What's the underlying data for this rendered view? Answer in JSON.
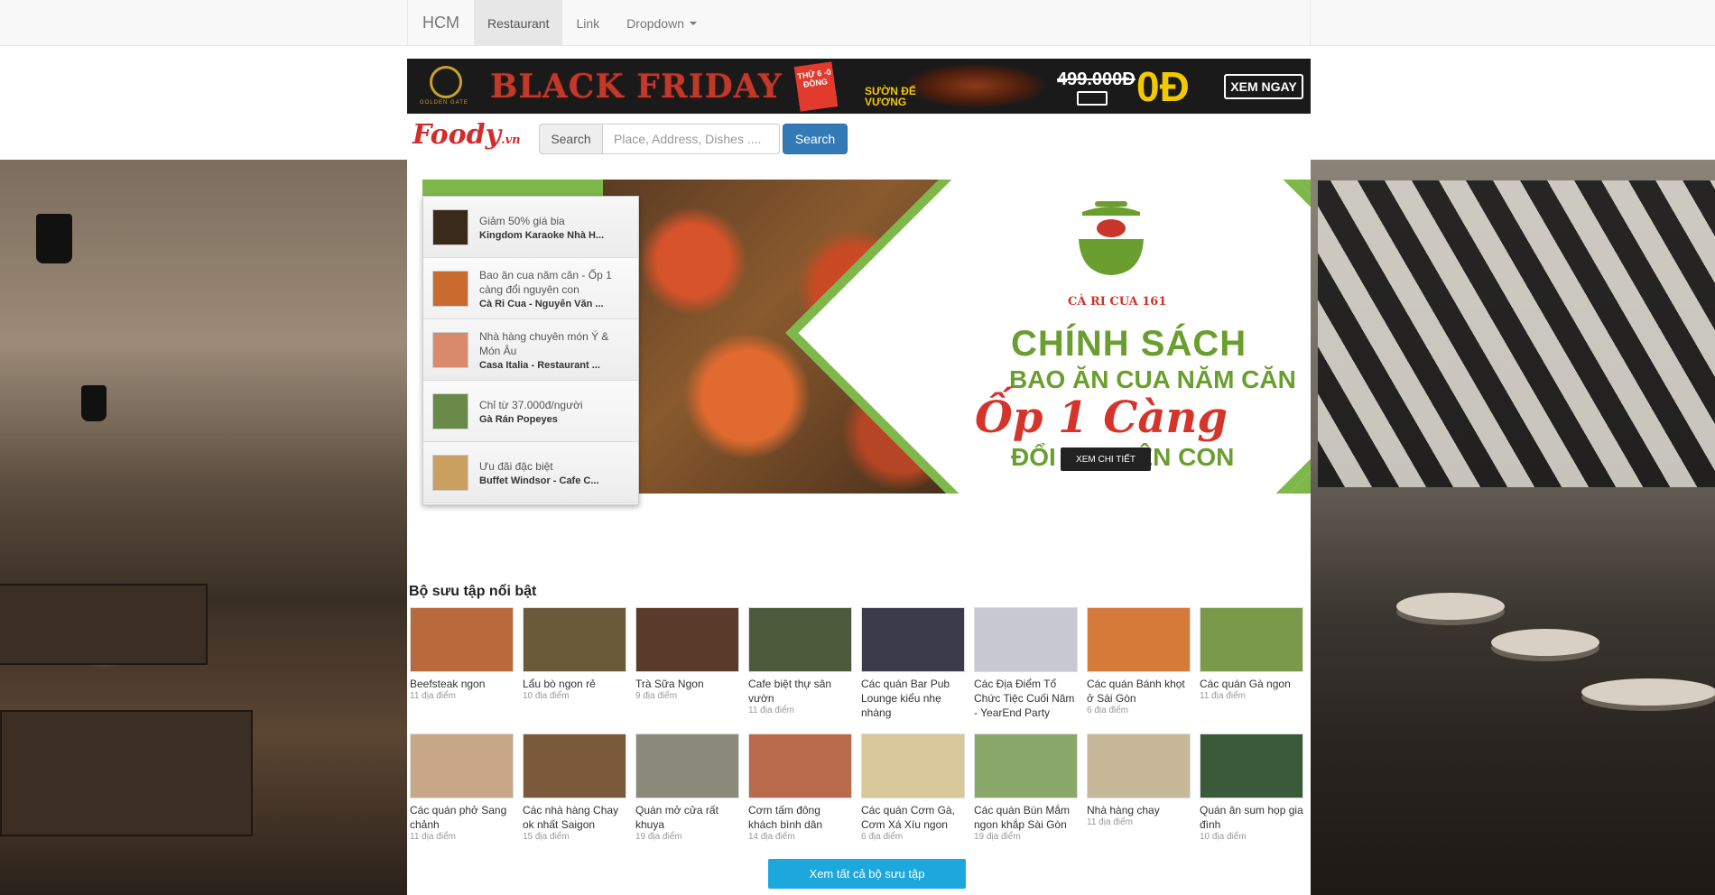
{
  "navbar": {
    "brand": "HCM",
    "items": [
      {
        "label": "Restaurant",
        "active": true
      },
      {
        "label": "Link",
        "active": false
      },
      {
        "label": "Dropdown",
        "active": false
      }
    ]
  },
  "ad_banner": {
    "logo_text": "GOLDEN GATE",
    "headline": "BLACK FRIDAY",
    "badge": "THỨ 6 -0 ĐỒNG",
    "product": "SƯỜN ĐẾ VƯƠNG",
    "old_price": "499.000Đ",
    "new_price": "0Đ",
    "cta": "XEM NGAY"
  },
  "header": {
    "logo": "Foody",
    "logo_suffix": ".vn",
    "search_addon": "Search",
    "search_placeholder": "Place, Address, Dishes ....",
    "search_button": "Search"
  },
  "promos": [
    {
      "title": "Giảm 50% giá bia",
      "subtitle": "Kingdom Karaoke Nhà H...",
      "thumb_color": "#3a2a1a"
    },
    {
      "title": "Bao ăn cua năm căn - Ốp 1 càng đổi nguyên con",
      "subtitle": "Cà Ri Cua - Nguyễn Văn ...",
      "thumb_color": "#c96a2e"
    },
    {
      "title": "Nhà hàng chuyên món Ý & Món Âu",
      "subtitle": "Casa Italia - Restaurant ...",
      "thumb_color": "#d98a6a"
    },
    {
      "title": "Chỉ từ 37.000đ/người",
      "subtitle": "Gà Rán Popeyes",
      "thumb_color": "#6a8a4a"
    },
    {
      "title": "Ưu đãi đặc biệt",
      "subtitle": "Buffet Windsor - Cafe C...",
      "thumb_color": "#c9a060"
    }
  ],
  "hero": {
    "brand_name": "CÀ RI CUA 161",
    "line1": "CHÍNH SÁCH",
    "line2": "BAO ĂN CUA NĂM CĂN",
    "line3": "Ốp 1 Càng",
    "line4": "ĐỔI NGUYÊN CON",
    "cta": "XEM CHI TIẾT"
  },
  "collections": {
    "title": "Bộ sưu tập nổi bật",
    "rows": [
      [
        {
          "title": "Beefsteak ngon",
          "count": "11 địa điểm",
          "color": "#b86a3c"
        },
        {
          "title": "Lẩu bò ngon rẻ",
          "count": "10 địa điểm",
          "color": "#6a5a3a"
        },
        {
          "title": "Trà Sữa Ngon",
          "count": "9 địa điểm",
          "color": "#5a3a2a"
        },
        {
          "title": "Cafe biệt thự sân vườn",
          "count": "11 địa điểm",
          "color": "#4a5a3a"
        },
        {
          "title": "Các quán Bar Pub Lounge kiểu nhẹ nhàng",
          "count": "",
          "color": "#3a3a4a"
        },
        {
          "title": "Các Địa Điểm Tổ Chức Tiệc Cuối Năm - YearEnd Party",
          "count": "",
          "color": "#c8c8d0"
        },
        {
          "title": "Các quán Bánh khọt ở Sài Gòn",
          "count": "6 địa điểm",
          "color": "#d67a3a"
        },
        {
          "title": "Các quán Gà ngon",
          "count": "11 địa điểm",
          "color": "#7a9a4a"
        }
      ],
      [
        {
          "title": "Các quán phở Sang chảnh",
          "count": "11 địa điểm",
          "color": "#c8a888"
        },
        {
          "title": "Các nhà hàng Chay ok nhất Saigon",
          "count": "15 địa điểm",
          "color": "#7a5a3a"
        },
        {
          "title": "Quán mở cửa rất khuya",
          "count": "19 địa điểm",
          "color": "#8a8a7a"
        },
        {
          "title": "Cơm tấm đông khách bình dân",
          "count": "14 địa điểm",
          "color": "#b86a4a"
        },
        {
          "title": "Các quán Cơm Gà, Cơm Xá Xíu ngon",
          "count": "6 địa điểm",
          "color": "#d8c89a"
        },
        {
          "title": "Các quán Bún Mắm ngon khắp Sài Gòn",
          "count": "19 địa điểm",
          "color": "#8aa86a"
        },
        {
          "title": "Nhà hàng chay",
          "count": "11 địa điểm",
          "color": "#c8b89a"
        },
        {
          "title": "Quán ăn sum họp gia đình",
          "count": "10 địa điểm",
          "color": "#3a5a3a"
        }
      ]
    ],
    "view_all": "Xem tất cả bộ sưu tập"
  }
}
